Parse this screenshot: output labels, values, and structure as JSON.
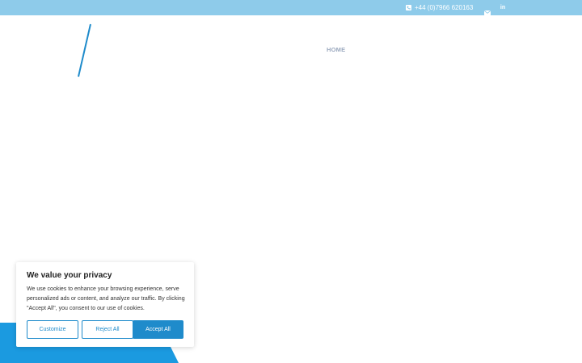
{
  "topbar": {
    "phone_icon": "phone-square-icon",
    "phone": "+44 (0)7966 620163",
    "mail_icon": "envelope-icon",
    "linkedin_icon": "linkedin-icon",
    "linkedin_text": "in"
  },
  "nav": {
    "home": "HOME"
  },
  "colors": {
    "topbar_bg": "#8ecbea",
    "accent": "#1f8bcb",
    "footer_shape": "#1b9ae0",
    "nav_text": "#9aa8be"
  },
  "cookie_banner": {
    "title": "We value your privacy",
    "body": "We use cookies to enhance your browsing experience, serve personalized ads or content, and analyze our traffic. By clicking \"Accept All\", you consent to our use of cookies.",
    "customize": "Customize",
    "reject": "Reject All",
    "accept": "Accept All"
  }
}
